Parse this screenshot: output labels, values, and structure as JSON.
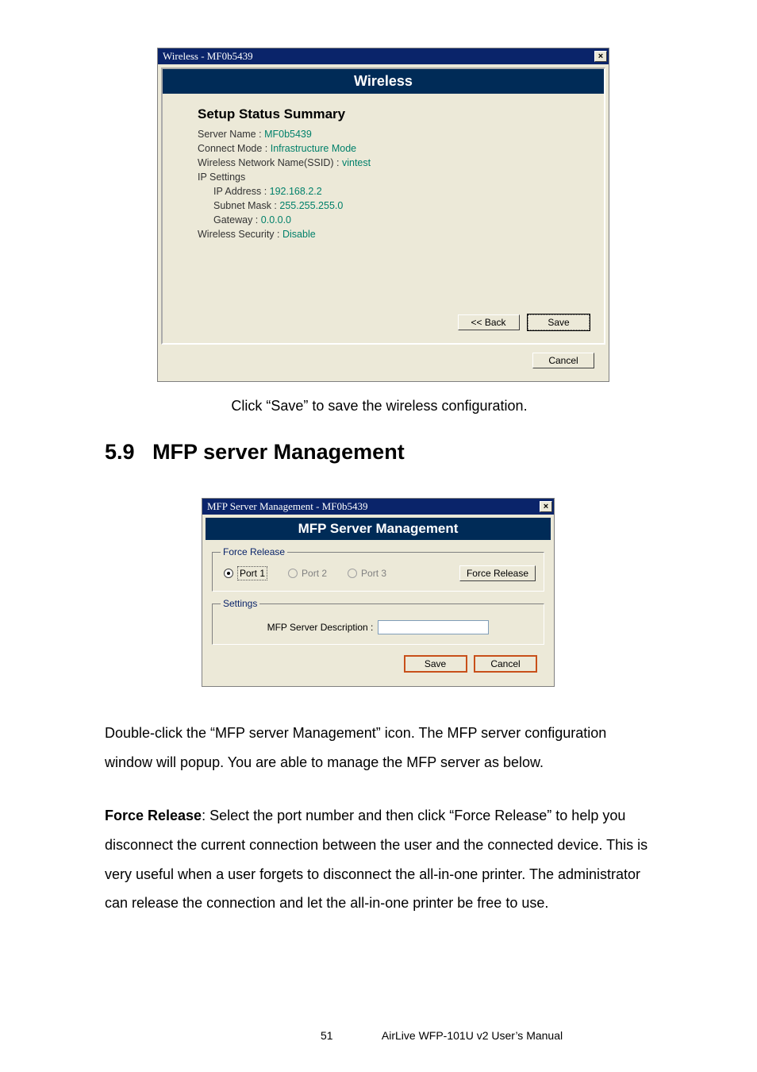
{
  "dialog1": {
    "window_title": "Wireless - MF0b5439",
    "banner": "Wireless",
    "summary_title": "Setup Status Summary",
    "server_name_label": "Server Name :",
    "server_name_value": "MF0b5439",
    "connect_mode_label": "Connect Mode :",
    "connect_mode_value": "Infrastructure Mode",
    "ssid_label": "Wireless Network Name(SSID) :",
    "ssid_value": "vintest",
    "ip_settings_label": "IP Settings",
    "ip_address_label": "IP Address :",
    "ip_address_value": "192.168.2.2",
    "subnet_label": "Subnet Mask :",
    "subnet_value": "255.255.255.0",
    "gateway_label": "Gateway :",
    "gateway_value": "0.0.0.0",
    "security_label": "Wireless Security :",
    "security_value": "Disable",
    "back_btn": "<< Back",
    "save_btn": "Save",
    "cancel_btn": "Cancel"
  },
  "caption1": "Click “Save” to save the wireless configuration.",
  "section": {
    "number": "5.9",
    "title": "MFP server Management"
  },
  "dialog2": {
    "window_title": "MFP Server Management - MF0b5439",
    "banner": "MFP Server Management",
    "group1_legend": "Force Release",
    "port1": "Port 1",
    "port2": "Port 2",
    "port3": "Port 3",
    "force_release_btn": "Force Release",
    "group2_legend": "Settings",
    "desc_label": "MFP Server Description :",
    "desc_value": "",
    "save_btn": "Save",
    "cancel_btn": "Cancel"
  },
  "para1": "Double-click the “MFP server Management” icon. The MFP server configuration window will popup. You are able to manage the MFP server as below.",
  "para2_bold": "Force Release",
  "para2_rest": ": Select the port number and then click “Force Release” to help you disconnect the current connection between the user and the connected device. This is very useful when a user forgets to disconnect the all-in-one printer. The administrator can release the connection and let the all-in-one printer be free to use.",
  "footer": {
    "page": "51",
    "manual": "AirLive WFP-101U v2 User’s Manual"
  }
}
